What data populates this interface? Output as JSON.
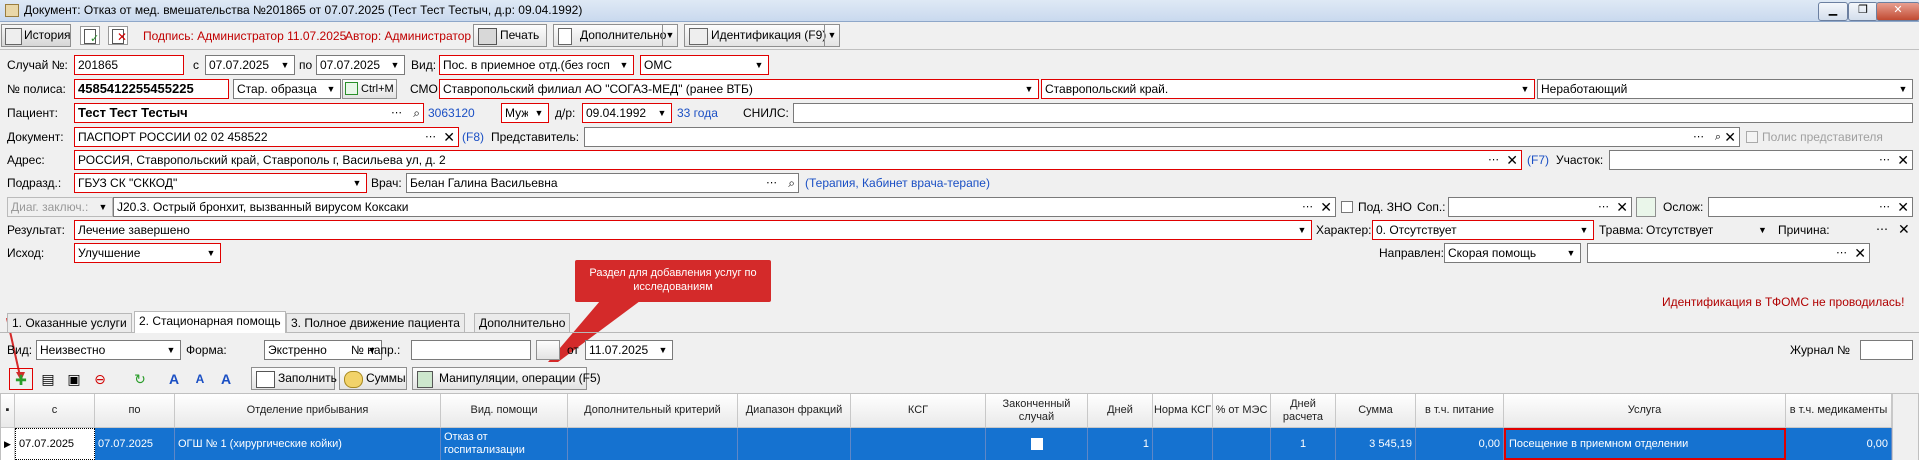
{
  "window": {
    "title": "Документ: Отказ от мед. вмешательства №201865 от 07.07.2025 (Тест Тест Тестыч, д.р: 09.04.1992)",
    "buttons": [
      "▁",
      "❐",
      "✕"
    ]
  },
  "toolbar": {
    "history": "История",
    "signature": "Подпись: Администратор 11.07.2025",
    "author": "Автор: Администратор",
    "print": "Печать",
    "extra": "Дополнительно",
    "ident": "Идентификация (F9)"
  },
  "form": {
    "case_label": "Случай №:",
    "case_value": "201865",
    "from_label": "с",
    "from_value": "07.07.2025",
    "to_label": "по",
    "to_value": "07.07.2025",
    "kind_label": "Вид:",
    "kind_value": "Пос. в приемное отд.(без госп",
    "payment_value": "ОМС",
    "policy_label": "№ полиса:",
    "policy_value": "4585412255455225",
    "policy_type": "Стар. образца",
    "ctrl_m": "Ctrl+M",
    "smo_label": "СМО:",
    "smo_value": "Ставропольский филиал АО \"СОГАЗ-МЕД\" (ранее ВТБ)",
    "region_value": "Ставропольский край.",
    "employment_value": "Неработающий",
    "patient_label": "Пациент:",
    "patient_value": "Тест Тест Тестыч",
    "patient_id": "3063120",
    "sex_value": "Муж.",
    "dob_label": "д/р:",
    "dob_value": "09.04.1992",
    "age": "33 года",
    "snils_label": "СНИЛС:",
    "doc_label": "Документ:",
    "doc_value": "ПАСПОРТ РОССИИ 02 02 458522",
    "f8": "(F8)",
    "rep_label": "Представитель:",
    "rep_policy": "Полис представителя",
    "addr_label": "Адрес:",
    "addr_value": "РОССИЯ, Ставропольский край, Ставрополь г, Васильева ул, д. 2",
    "f7": "(F7)",
    "area_label": "Участок:",
    "dept_label": "Подразд.:",
    "dept_value": "ГБУЗ СК \"СККОД\"",
    "doctor_label": "Врач:",
    "doctor_value": "Белан Галина Васильевна",
    "doctor_info": "(Терапия, Кабинет врача-терапе)",
    "diag_label": "Диаг. заключ.:",
    "diag_value": "J20.3. Острый бронхит, вызванный вирусом Коксаки",
    "zno_label": "Под. ЗНО",
    "sop_label": "Соп.:",
    "osl_label": "Ослож:",
    "result_label": "Результат:",
    "result_value": "Лечение завершено",
    "character_label": "Характер:",
    "character_value": "0. Отсутствует",
    "trauma_label": "Травма:",
    "trauma_value": "Отсутствует",
    "reason_label": "Причина:",
    "outcome_label": "Исход:",
    "outcome_value": "Улучшение",
    "direction_label": "Направлен:",
    "direction_value": "Скорая помощь",
    "tfoms_warning": "Идентификация в ТФОМС не проводилась!"
  },
  "callout": "Раздел для добавления услуг по исследованиям",
  "tabs": [
    "1. Оказанные услуги",
    "2. Стационарная помощь",
    "3. Полное движение пациента",
    "Дополнительно"
  ],
  "subform": {
    "kind_label": "Вид:",
    "kind_value": "Неизвестно",
    "form_label": "Форма:",
    "form_value": "Экстренно",
    "dir_label": "№ напр.:",
    "from_label": "от",
    "from_value": "11.07.2025",
    "journal_label": "Журнал №"
  },
  "actions": {
    "fill": "Заполнить",
    "sums": "Суммы",
    "manip": "Манипуляции, операции (F5)"
  },
  "grid": {
    "headers": [
      "с",
      "по",
      "Отделение прибывания",
      "Вид. помощи",
      "Дополнительный критерий",
      "Диапазон фракций",
      "КСГ",
      "Законченный случай",
      "Дней",
      "Норма КСГ",
      "% от МЭС",
      "Дней расчета",
      "Сумма",
      "в т.ч. питание",
      "Услуга",
      "в т.ч. медикаменты"
    ],
    "row": {
      "from": "07.07.2025",
      "to": "07.07.2025",
      "dept": "ОГШ № 1 (хирургические койки)",
      "help": "Отказ от госпитализации",
      "days": "1",
      "calc_days": "1",
      "sum": "3 545,19",
      "food": "0,00",
      "service": "Посещение в приемном отделении",
      "meds": "0,00"
    }
  },
  "colors": {
    "selection": "#1572d0",
    "error_border": "#e00000",
    "link": "#1a4fc4",
    "callout": "#d42a2a"
  }
}
